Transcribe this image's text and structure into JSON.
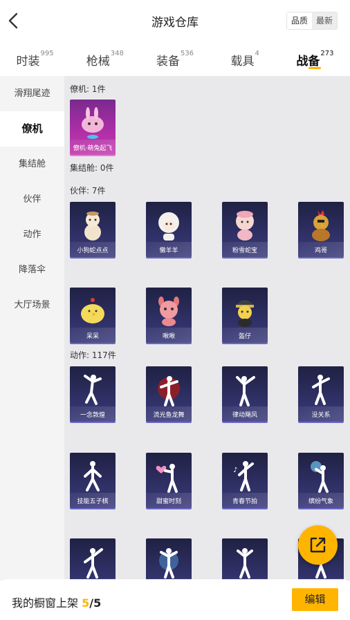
{
  "header": {
    "title": "游戏仓库",
    "sort_quality": "品质",
    "sort_latest": "最新"
  },
  "tabs": [
    {
      "label": "时装",
      "count": "995"
    },
    {
      "label": "枪械",
      "count": "348"
    },
    {
      "label": "装备",
      "count": "536"
    },
    {
      "label": "载具",
      "count": "4"
    },
    {
      "label": "战备",
      "count": "273"
    }
  ],
  "sidebar": [
    {
      "label": "滑翔尾迹"
    },
    {
      "label": "僚机"
    },
    {
      "label": "集结舱"
    },
    {
      "label": "伙伴"
    },
    {
      "label": "动作"
    },
    {
      "label": "降落伞"
    },
    {
      "label": "大厅场景"
    }
  ],
  "sections": {
    "wingman": {
      "title": "僚机: 1件",
      "items": [
        "僚机·萌兔起飞"
      ]
    },
    "capsule": {
      "title": "集结舱: 0件"
    },
    "partner": {
      "title": "伙伴: 7件",
      "items": [
        "小狗蛇点点",
        "懒羊羊",
        "粉雪蛇宝",
        "鸡哥",
        "呆呆",
        "啾啾",
        "盔仔"
      ]
    },
    "emote": {
      "title": "动作: 117件",
      "items": [
        "一念敦煌",
        "流光鱼龙舞",
        "律动飓风",
        "没关系",
        "技能五子棋",
        "甜蜜时刻",
        "青春节拍",
        "缤纷气象",
        "",
        "",
        "",
        ""
      ]
    }
  },
  "bottom": {
    "prefix": "我的橱窗上架 ",
    "current": "5",
    "slash": "/",
    "total": "5",
    "edit_label": "编辑"
  },
  "colors": {
    "accent": "#ffb400",
    "card_dark": "#2e2f63",
    "card_pink": "#b02fa8"
  }
}
